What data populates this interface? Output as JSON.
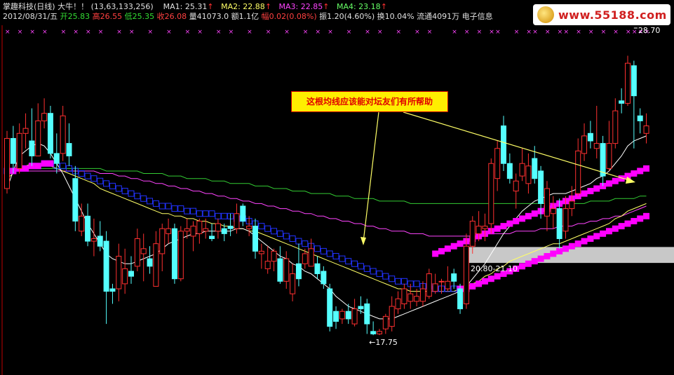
{
  "header": {
    "stock_title": "掌趣科技(日线)",
    "bull_text": "大牛！！",
    "params": "(13,63,133,256)",
    "ma1_label": "MA1: 25.31",
    "ma2_label": "MA2: 22.88",
    "ma3_label": "MA3: 22.85",
    "ma4_label": "MA4: 23.18",
    "up_arrow": "↑",
    "date": "2012/08/31/五",
    "open_label": "开",
    "open_value": "25.83",
    "high_label": "高",
    "high_value": "26.55",
    "low_label": "低",
    "low_value": "25.35",
    "close_label": "收",
    "close_value": "26.08",
    "volume_label": "量",
    "volume_value": "41073.0",
    "amount_label": "额",
    "amount_value": "1.1亿",
    "change_label": "幅",
    "change_value": "0.02(0.08%)",
    "amplitude_label": "振",
    "amplitude_value": "1.20(4.60%)",
    "turnover_label": "换",
    "turnover_value": "10.04%",
    "float_label": "流通",
    "float_value": "4091万",
    "sector": "电子信息"
  },
  "logo": {
    "text": "www.55188.com"
  },
  "annotation": {
    "text": "这根均线应该能对坛友们有所帮助"
  },
  "colors": {
    "up_candle": "#ff3030",
    "down_candle": "#55ffff",
    "ma1": "#ffffff",
    "ma2": "#ffff66",
    "ma3": "#ff44ff",
    "ma4": "#33cc33",
    "step_line_blue": "#2233ff",
    "step_line_magenta": "#ff00ff",
    "signal_x": "#ff44ff",
    "arrow": "#ffff66",
    "zone": "#c8c8c8"
  },
  "chart_data": {
    "type": "candlestick",
    "y_range": [
      17.0,
      29.5
    ],
    "candles": [
      {
        "o": 23.6,
        "c": 25.6,
        "h": 25.9,
        "l": 23.4
      },
      {
        "o": 25.6,
        "c": 24.6,
        "h": 26.1,
        "l": 24.2
      },
      {
        "o": 24.4,
        "c": 25.8,
        "h": 26.2,
        "l": 24.2
      },
      {
        "o": 25.8,
        "c": 26.0,
        "h": 26.6,
        "l": 25.2
      },
      {
        "o": 25.5,
        "c": 24.9,
        "h": 26.8,
        "l": 24.5
      },
      {
        "o": 24.9,
        "c": 26.3,
        "h": 27.0,
        "l": 24.9
      },
      {
        "o": 26.3,
        "c": 26.6,
        "h": 27.2,
        "l": 26.0
      },
      {
        "o": 26.6,
        "c": 25.0,
        "h": 26.9,
        "l": 24.8
      },
      {
        "o": 25.0,
        "c": 24.6,
        "h": 25.8,
        "l": 24.2
      },
      {
        "o": 25.0,
        "c": 26.5,
        "h": 26.9,
        "l": 24.7
      },
      {
        "o": 25.4,
        "c": 24.9,
        "h": 26.2,
        "l": 24.5
      },
      {
        "o": 24.0,
        "c": 22.3,
        "h": 24.5,
        "l": 21.9
      },
      {
        "o": 21.9,
        "c": 22.5,
        "h": 23.0,
        "l": 21.7
      },
      {
        "o": 22.5,
        "c": 21.5,
        "h": 23.0,
        "l": 21.3
      },
      {
        "o": 21.5,
        "c": 21.6,
        "h": 22.4,
        "l": 20.9
      },
      {
        "o": 21.7,
        "c": 21.3,
        "h": 22.3,
        "l": 21.1
      },
      {
        "o": 21.5,
        "c": 19.5,
        "h": 21.9,
        "l": 18.2
      },
      {
        "o": 19.6,
        "c": 19.5,
        "h": 19.8,
        "l": 19.0
      },
      {
        "o": 19.6,
        "c": 20.9,
        "h": 21.4,
        "l": 19.1
      },
      {
        "o": 19.8,
        "c": 20.4,
        "h": 21.2,
        "l": 19.4
      },
      {
        "o": 20.3,
        "c": 20.1,
        "h": 20.9,
        "l": 19.8
      },
      {
        "o": 20.5,
        "c": 21.6,
        "h": 22.0,
        "l": 20.3
      },
      {
        "o": 21.0,
        "c": 21.2,
        "h": 21.8,
        "l": 19.9
      },
      {
        "o": 20.8,
        "c": 20.5,
        "h": 21.3,
        "l": 20.2
      },
      {
        "o": 19.7,
        "c": 21.4,
        "h": 21.9,
        "l": 19.7
      },
      {
        "o": 21.0,
        "c": 22.0,
        "h": 22.2,
        "l": 20.3
      },
      {
        "o": 21.8,
        "c": 22.0,
        "h": 22.4,
        "l": 21.4
      },
      {
        "o": 22.0,
        "c": 20.0,
        "h": 22.2,
        "l": 19.8
      },
      {
        "o": 20.0,
        "c": 21.9,
        "h": 22.1,
        "l": 19.9
      },
      {
        "o": 21.9,
        "c": 22.0,
        "h": 22.4,
        "l": 21.6
      },
      {
        "o": 21.7,
        "c": 22.1,
        "h": 22.3,
        "l": 21.1
      },
      {
        "o": 21.8,
        "c": 22.3,
        "h": 22.4,
        "l": 21.4
      },
      {
        "o": 21.9,
        "c": 22.0,
        "h": 22.4,
        "l": 21.6
      },
      {
        "o": 21.7,
        "c": 21.6,
        "h": 22.2,
        "l": 21.5
      },
      {
        "o": 21.9,
        "c": 22.2,
        "h": 22.4,
        "l": 21.6
      },
      {
        "o": 22.0,
        "c": 21.8,
        "h": 22.2,
        "l": 21.5
      },
      {
        "o": 22.1,
        "c": 22.0,
        "h": 22.6,
        "l": 21.7
      },
      {
        "o": 22.0,
        "c": 22.6,
        "h": 23.0,
        "l": 21.8
      },
      {
        "o": 22.9,
        "c": 22.3,
        "h": 23.0,
        "l": 22.1
      },
      {
        "o": 22.0,
        "c": 22.1,
        "h": 22.5,
        "l": 21.7
      },
      {
        "o": 22.1,
        "c": 21.1,
        "h": 22.4,
        "l": 20.8
      },
      {
        "o": 21.0,
        "c": 21.1,
        "h": 21.4,
        "l": 20.4
      },
      {
        "o": 20.4,
        "c": 20.7,
        "h": 21.3,
        "l": 20.2
      },
      {
        "o": 20.7,
        "c": 21.1,
        "h": 21.2,
        "l": 20.3
      },
      {
        "o": 20.8,
        "c": 19.9,
        "h": 21.3,
        "l": 19.8
      },
      {
        "o": 19.9,
        "c": 20.8,
        "h": 21.1,
        "l": 19.6
      },
      {
        "o": 19.4,
        "c": 20.2,
        "h": 20.6,
        "l": 19.1
      },
      {
        "o": 20.6,
        "c": 20.0,
        "h": 21.4,
        "l": 19.7
      },
      {
        "o": 20.6,
        "c": 21.0,
        "h": 21.2,
        "l": 20.4
      },
      {
        "o": 20.5,
        "c": 21.2,
        "h": 21.6,
        "l": 20.5
      },
      {
        "o": 20.6,
        "c": 20.2,
        "h": 20.9,
        "l": 20.0
      },
      {
        "o": 20.3,
        "c": 19.8,
        "h": 20.5,
        "l": 19.6
      },
      {
        "o": 19.6,
        "c": 18.1,
        "h": 19.8,
        "l": 17.9
      },
      {
        "o": 18.7,
        "c": 18.3,
        "h": 18.9,
        "l": 18.0
      },
      {
        "o": 18.4,
        "c": 18.7,
        "h": 18.8,
        "l": 18.2
      },
      {
        "o": 18.7,
        "c": 18.4,
        "h": 19.0,
        "l": 18.2
      },
      {
        "o": 18.2,
        "c": 18.8,
        "h": 19.2,
        "l": 18.1
      },
      {
        "o": 18.9,
        "c": 18.8,
        "h": 19.3,
        "l": 18.6
      },
      {
        "o": 19.0,
        "c": 18.2,
        "h": 19.2,
        "l": 17.8
      },
      {
        "o": 17.9,
        "c": 17.8,
        "h": 18.3,
        "l": 17.75
      },
      {
        "o": 17.8,
        "c": 17.9,
        "h": 18.0,
        "l": 17.75
      },
      {
        "o": 18.0,
        "c": 18.5,
        "h": 18.6,
        "l": 17.8
      },
      {
        "o": 18.1,
        "c": 18.9,
        "h": 19.3,
        "l": 17.9
      },
      {
        "o": 18.8,
        "c": 19.2,
        "h": 19.5,
        "l": 18.6
      },
      {
        "o": 19.0,
        "c": 19.6,
        "h": 19.8,
        "l": 18.8
      },
      {
        "o": 19.1,
        "c": 19.4,
        "h": 19.8,
        "l": 18.8
      },
      {
        "o": 19.1,
        "c": 19.3,
        "h": 19.6,
        "l": 18.9
      },
      {
        "o": 19.1,
        "c": 19.6,
        "h": 19.9,
        "l": 18.9
      },
      {
        "o": 19.3,
        "c": 20.2,
        "h": 20.4,
        "l": 19.2
      },
      {
        "o": 19.5,
        "c": 19.8,
        "h": 20.2,
        "l": 19.4
      },
      {
        "o": 19.9,
        "c": 19.9,
        "h": 20.0,
        "l": 19.4
      },
      {
        "o": 19.6,
        "c": 19.9,
        "h": 20.5,
        "l": 19.5
      },
      {
        "o": 20.2,
        "c": 19.9,
        "h": 20.4,
        "l": 19.6
      },
      {
        "o": 19.6,
        "c": 18.8,
        "h": 19.8,
        "l": 18.6
      },
      {
        "o": 19.0,
        "c": 21.3,
        "h": 21.8,
        "l": 18.8
      },
      {
        "o": 21.3,
        "c": 22.3,
        "h": 22.5,
        "l": 21.0
      },
      {
        "o": 21.8,
        "c": 22.1,
        "h": 22.7,
        "l": 21.5
      },
      {
        "o": 22.0,
        "c": 22.1,
        "h": 22.6,
        "l": 21.5
      },
      {
        "o": 22.2,
        "c": 24.6,
        "h": 24.8,
        "l": 21.8
      },
      {
        "o": 24.0,
        "c": 25.2,
        "h": 25.5,
        "l": 23.5
      },
      {
        "o": 26.1,
        "c": 24.6,
        "h": 26.5,
        "l": 24.3
      },
      {
        "o": 24.6,
        "c": 24.0,
        "h": 25.0,
        "l": 23.8
      },
      {
        "o": 23.5,
        "c": 23.9,
        "h": 24.2,
        "l": 22.8
      },
      {
        "o": 24.1,
        "c": 24.6,
        "h": 25.2,
        "l": 23.9
      },
      {
        "o": 23.8,
        "c": 24.5,
        "h": 25.0,
        "l": 23.4
      },
      {
        "o": 24.8,
        "c": 24.0,
        "h": 25.3,
        "l": 23.8
      },
      {
        "o": 24.3,
        "c": 23.0,
        "h": 24.5,
        "l": 22.4
      },
      {
        "o": 22.5,
        "c": 23.6,
        "h": 23.9,
        "l": 21.9
      },
      {
        "o": 22.6,
        "c": 22.8,
        "h": 23.3,
        "l": 22.0
      },
      {
        "o": 22.8,
        "c": 21.6,
        "h": 23.2,
        "l": 21.2
      },
      {
        "o": 21.9,
        "c": 22.8,
        "h": 23.3,
        "l": 21.6
      },
      {
        "o": 22.8,
        "c": 23.1,
        "h": 23.7,
        "l": 22.5
      },
      {
        "o": 23.4,
        "c": 25.1,
        "h": 25.6,
        "l": 23.3
      },
      {
        "o": 25.0,
        "c": 25.7,
        "h": 26.2,
        "l": 24.7
      },
      {
        "o": 25.8,
        "c": 25.5,
        "h": 26.3,
        "l": 25.2
      },
      {
        "o": 25.2,
        "c": 25.4,
        "h": 26.9,
        "l": 24.8
      },
      {
        "o": 25.4,
        "c": 24.1,
        "h": 25.7,
        "l": 23.7
      },
      {
        "o": 24.4,
        "c": 25.4,
        "h": 26.3,
        "l": 24.3
      },
      {
        "o": 25.4,
        "c": 26.7,
        "h": 27.2,
        "l": 25.2
      },
      {
        "o": 27.1,
        "c": 27.0,
        "h": 27.6,
        "l": 26.6
      },
      {
        "o": 27.0,
        "c": 28.6,
        "h": 28.9,
        "l": 26.9
      },
      {
        "o": 28.5,
        "c": 27.3,
        "h": 28.7,
        "l": 25.2
      },
      {
        "o": 26.5,
        "c": 26.3,
        "h": 26.8,
        "l": 25.8
      },
      {
        "o": 25.8,
        "c": 26.1,
        "h": 26.6,
        "l": 25.4
      }
    ],
    "ma1": [
      23.6,
      24.3,
      24.9,
      25.1,
      25.3,
      25.4,
      25.3,
      25.0,
      24.6,
      24.2,
      23.7,
      23.2,
      22.7,
      22.2,
      21.8,
      21.4,
      21.0,
      20.8,
      20.7,
      20.6,
      20.6,
      20.7,
      20.8,
      20.9,
      21.0,
      21.2,
      21.4,
      21.5,
      21.6,
      21.7,
      21.8,
      21.8,
      21.9,
      21.9,
      21.9,
      21.9,
      21.9,
      22.0,
      22.0,
      21.9,
      21.7,
      21.5,
      21.3,
      21.1,
      20.9,
      20.8,
      20.6,
      20.5,
      20.3,
      20.2,
      20.0,
      19.8,
      19.6,
      19.3,
      19.1,
      18.9,
      18.8,
      18.7,
      18.6,
      18.5,
      18.4,
      18.4,
      18.4,
      18.5,
      18.6,
      18.7,
      18.8,
      18.9,
      19.0,
      19.1,
      19.2,
      19.3,
      19.4,
      19.5,
      19.7,
      20.0,
      20.3,
      20.6,
      21.0,
      21.4,
      21.8,
      22.1,
      22.4,
      22.7,
      22.9,
      23.1,
      23.2,
      23.3,
      23.4,
      23.4,
      23.4,
      23.5,
      23.6,
      23.7,
      23.8,
      24.0,
      24.1,
      24.3,
      24.6,
      24.9,
      25.3,
      25.5,
      25.6,
      25.7
    ],
    "ma2": [
      24.0,
      24.2,
      24.4,
      24.5,
      24.6,
      24.6,
      24.6,
      24.5,
      24.4,
      24.3,
      24.2,
      24.1,
      24.0,
      23.9,
      23.8,
      23.6,
      23.5,
      23.4,
      23.3,
      23.2,
      23.1,
      23.0,
      22.9,
      22.8,
      22.7,
      22.6,
      22.6,
      22.5,
      22.5,
      22.4,
      22.4,
      22.3,
      22.3,
      22.2,
      22.2,
      22.1,
      22.1,
      22.0,
      22.0,
      21.9,
      21.9,
      21.8,
      21.7,
      21.6,
      21.5,
      21.4,
      21.3,
      21.2,
      21.1,
      21.0,
      20.9,
      20.8,
      20.7,
      20.6,
      20.5,
      20.4,
      20.3,
      20.2,
      20.1,
      20.0,
      19.9,
      19.8,
      19.7,
      19.6,
      19.6,
      19.5,
      19.5,
      19.5,
      19.5,
      19.5,
      19.5,
      19.5,
      19.5,
      19.6,
      19.7,
      19.8,
      19.9,
      20.1,
      20.2,
      20.4,
      20.5,
      20.7,
      20.8,
      20.9,
      21.0,
      21.1,
      21.2,
      21.3,
      21.4,
      21.4,
      21.5,
      21.6,
      21.7,
      21.8,
      21.9,
      22.0,
      22.1,
      22.2,
      22.4,
      22.5,
      22.7,
      22.8,
      22.9,
      23.0
    ],
    "ma3": [
      24.3,
      24.3,
      24.3,
      24.3,
      24.3,
      24.3,
      24.3,
      24.3,
      24.3,
      24.3,
      24.3,
      24.3,
      24.3,
      24.3,
      24.3,
      24.2,
      24.2,
      24.2,
      24.1,
      24.1,
      24.0,
      24.0,
      23.9,
      23.9,
      23.8,
      23.8,
      23.7,
      23.7,
      23.6,
      23.6,
      23.5,
      23.5,
      23.4,
      23.4,
      23.3,
      23.3,
      23.2,
      23.2,
      23.1,
      23.1,
      23.0,
      23.0,
      22.9,
      22.9,
      22.8,
      22.8,
      22.7,
      22.7,
      22.6,
      22.6,
      22.5,
      22.5,
      22.4,
      22.4,
      22.3,
      22.3,
      22.2,
      22.2,
      22.1,
      22.1,
      22.0,
      22.0,
      21.9,
      21.9,
      21.9,
      21.8,
      21.8,
      21.8,
      21.7,
      21.7,
      21.7,
      21.7,
      21.7,
      21.7,
      21.7,
      21.7,
      21.7,
      21.8,
      21.8,
      21.8,
      21.8,
      21.8,
      21.9,
      21.9,
      21.9,
      21.9,
      22.0,
      22.0,
      22.0,
      22.1,
      22.1,
      22.1,
      22.2,
      22.2,
      22.3,
      22.3,
      22.4,
      22.4,
      22.5,
      22.5,
      22.6,
      22.7,
      22.8,
      22.9
    ],
    "ma4": [
      24.4,
      24.4,
      24.4,
      24.4,
      24.4,
      24.4,
      24.4,
      24.4,
      24.4,
      24.4,
      24.4,
      24.4,
      24.4,
      24.4,
      24.4,
      24.4,
      24.3,
      24.3,
      24.3,
      24.3,
      24.3,
      24.3,
      24.2,
      24.2,
      24.2,
      24.2,
      24.1,
      24.1,
      24.1,
      24.0,
      24.0,
      24.0,
      24.0,
      23.9,
      23.9,
      23.9,
      23.8,
      23.8,
      23.8,
      23.8,
      23.7,
      23.7,
      23.7,
      23.6,
      23.6,
      23.6,
      23.5,
      23.5,
      23.5,
      23.4,
      23.4,
      23.4,
      23.4,
      23.3,
      23.3,
      23.3,
      23.2,
      23.2,
      23.2,
      23.2,
      23.1,
      23.1,
      23.1,
      23.1,
      23.1,
      23.0,
      23.0,
      23.0,
      23.0,
      23.0,
      23.0,
      23.0,
      23.0,
      23.0,
      23.0,
      23.0,
      23.0,
      23.0,
      23.0,
      23.0,
      23.0,
      23.0,
      23.0,
      23.0,
      23.0,
      23.0,
      23.0,
      23.0,
      23.0,
      23.0,
      23.0,
      23.0,
      23.0,
      23.0,
      23.1,
      23.1,
      23.1,
      23.1,
      23.2,
      23.2,
      23.2,
      23.2,
      23.3,
      23.3
    ],
    "step_line": [
      24.3,
      24.3,
      24.4,
      24.4,
      24.5,
      24.5,
      24.6,
      24.6,
      24.5,
      24.5,
      24.4,
      24.3,
      24.2,
      24.1,
      24.0,
      23.9,
      23.8,
      23.7,
      23.6,
      23.5,
      23.4,
      23.3,
      23.2,
      23.1,
      23.0,
      22.9,
      22.9,
      22.8,
      22.8,
      22.7,
      22.7,
      22.6,
      22.6,
      22.6,
      22.5,
      22.5,
      22.5,
      22.4,
      22.4,
      22.3,
      22.2,
      22.1,
      22.0,
      21.9,
      21.8,
      21.7,
      21.6,
      21.5,
      21.4,
      21.3,
      21.2,
      21.1,
      21.0,
      20.9,
      20.8,
      20.7,
      20.6,
      20.5,
      20.4,
      20.3,
      20.2,
      20.1,
      20.0,
      19.9,
      19.9,
      19.8,
      19.8,
      19.7,
      19.7,
      19.6,
      19.6,
      19.6,
      19.6,
      19.6,
      19.6,
      19.7,
      19.8,
      19.9,
      20.0,
      20.1,
      20.2,
      20.3,
      20.4,
      20.5,
      20.6,
      20.7,
      20.8,
      20.9,
      21.0,
      21.1,
      21.2,
      21.3,
      21.4,
      21.5,
      21.6,
      21.7,
      21.8,
      21.9,
      22.0,
      22.1,
      22.2,
      22.3,
      22.4,
      22.5
    ],
    "step_magenta_start": 73,
    "step_magenta_tail": [
      24.4,
      24.3,
      24.2,
      24.1,
      24.0,
      23.9,
      23.8,
      23.7,
      23.6,
      23.5,
      23.4,
      23.3,
      23.2,
      23.1,
      23.0,
      22.9,
      22.8,
      22.7,
      22.6,
      22.5,
      22.4,
      22.3,
      22.2,
      22.1,
      22.0,
      21.9,
      21.8,
      21.7,
      21.6,
      21.5,
      21.4,
      21.3,
      21.2,
      21.1,
      21.0
    ],
    "signal_x_indices": [
      0,
      2,
      4,
      6,
      9,
      11,
      13,
      15,
      18,
      20,
      23,
      26,
      29,
      31,
      34,
      36,
      39,
      42,
      45,
      48,
      50,
      52,
      55,
      58,
      60,
      63,
      66,
      68,
      72,
      74,
      76,
      78,
      79,
      82,
      84,
      85,
      87,
      89,
      90,
      92,
      94,
      96,
      98,
      100,
      101,
      102,
      103
    ],
    "zone": {
      "low": 20.8,
      "high": 21.1,
      "label": "20.80-21.10"
    },
    "low_marker": {
      "index": 59,
      "value": 17.75,
      "label": "←17.75"
    },
    "high_marker": {
      "index": 101,
      "value": 28.7,
      "label": "28.70"
    }
  }
}
